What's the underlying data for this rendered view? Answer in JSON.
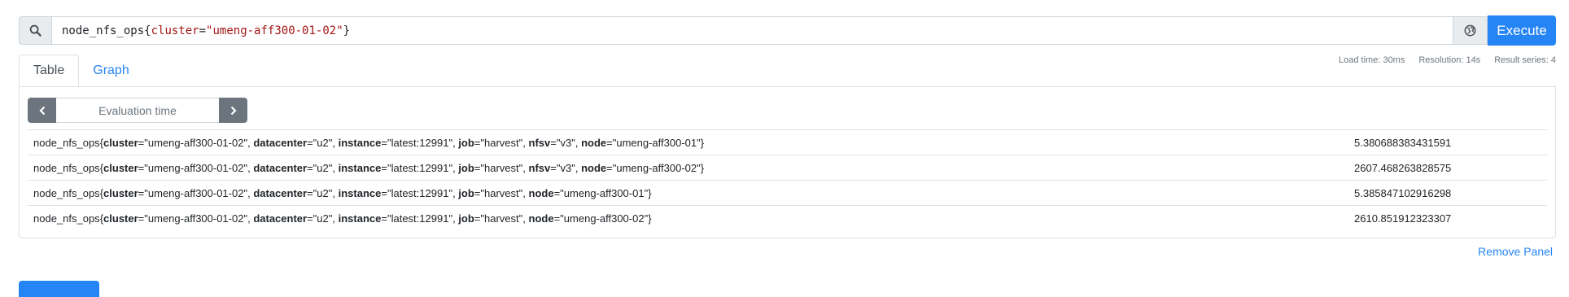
{
  "query": {
    "metric": "node_nfs_ops",
    "open_brace": "{",
    "label_name": "cluster",
    "equals": "=",
    "label_value": "\"umeng-aff300-01-02\"",
    "close_brace": "}",
    "execute_label": "Execute",
    "icons": {
      "search": "search-icon",
      "metrics_explorer": "globe-icon"
    }
  },
  "tabs": [
    {
      "label": "Table",
      "active": true
    },
    {
      "label": "Graph",
      "active": false
    }
  ],
  "stats": {
    "load_time": "Load time: 30ms",
    "resolution": "Resolution: 14s",
    "result_series": "Result series: 4"
  },
  "eval": {
    "placeholder": "Evaluation time",
    "prev_icon": "chevron-left-icon",
    "next_icon": "chevron-right-icon"
  },
  "results": [
    {
      "metric": "node_nfs_ops",
      "labels": [
        {
          "name": "cluster",
          "value": "umeng-aff300-01-02"
        },
        {
          "name": "datacenter",
          "value": "u2"
        },
        {
          "name": "instance",
          "value": "latest:12991"
        },
        {
          "name": "job",
          "value": "harvest"
        },
        {
          "name": "nfsv",
          "value": "v3"
        },
        {
          "name": "node",
          "value": "umeng-aff300-01"
        }
      ],
      "value": "5.380688383431591"
    },
    {
      "metric": "node_nfs_ops",
      "labels": [
        {
          "name": "cluster",
          "value": "umeng-aff300-01-02"
        },
        {
          "name": "datacenter",
          "value": "u2"
        },
        {
          "name": "instance",
          "value": "latest:12991"
        },
        {
          "name": "job",
          "value": "harvest"
        },
        {
          "name": "nfsv",
          "value": "v3"
        },
        {
          "name": "node",
          "value": "umeng-aff300-02"
        }
      ],
      "value": "2607.468263828575"
    },
    {
      "metric": "node_nfs_ops",
      "labels": [
        {
          "name": "cluster",
          "value": "umeng-aff300-01-02"
        },
        {
          "name": "datacenter",
          "value": "u2"
        },
        {
          "name": "instance",
          "value": "latest:12991"
        },
        {
          "name": "job",
          "value": "harvest"
        },
        {
          "name": "node",
          "value": "umeng-aff300-01"
        }
      ],
      "value": "5.385847102916298"
    },
    {
      "metric": "node_nfs_ops",
      "labels": [
        {
          "name": "cluster",
          "value": "umeng-aff300-01-02"
        },
        {
          "name": "datacenter",
          "value": "u2"
        },
        {
          "name": "instance",
          "value": "latest:12991"
        },
        {
          "name": "job",
          "value": "harvest"
        },
        {
          "name": "node",
          "value": "umeng-aff300-02"
        }
      ],
      "value": "2610.851912323307"
    }
  ],
  "remove_panel_label": "Remove Panel",
  "colors": {
    "primary": "#2585f5",
    "secondary": "#6c757d",
    "border": "#dee2e6",
    "string_literal": "#a31515"
  }
}
